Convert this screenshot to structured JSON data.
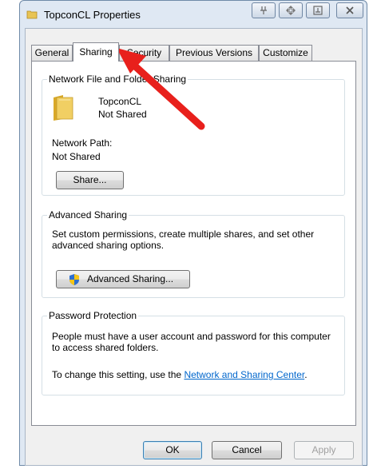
{
  "window": {
    "title": "TopconCL Properties"
  },
  "tabs": [
    "General",
    "Sharing",
    "Security",
    "Previous Versions",
    "Customize"
  ],
  "active_tab": "Sharing",
  "network_sharing": {
    "title": "Network File and Folder Sharing",
    "folder_name": "TopconCL",
    "folder_status": "Not Shared",
    "path_label": "Network Path:",
    "path_value": "Not Shared",
    "share_button": "Share..."
  },
  "advanced_sharing": {
    "title": "Advanced Sharing",
    "description": "Set custom permissions, create multiple shares, and set other advanced sharing options.",
    "button": "Advanced Sharing..."
  },
  "password_protection": {
    "title": "Password Protection",
    "description": "People must have a user account and password for this computer to access shared folders.",
    "change_prefix": "To change this setting, use the ",
    "link": "Network and Sharing Center",
    "change_suffix": "."
  },
  "footer": {
    "ok": "OK",
    "cancel": "Cancel",
    "apply": "Apply"
  },
  "annotation_color": "#e8201c"
}
